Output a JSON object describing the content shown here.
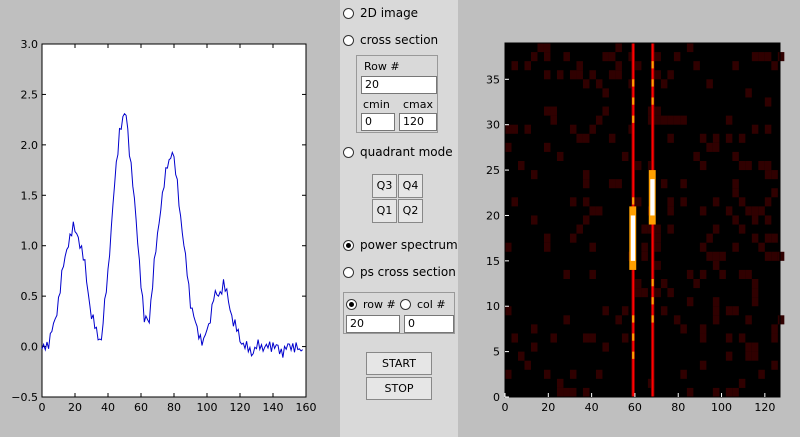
{
  "controls": {
    "mode_2d_image": {
      "label": "2D image",
      "selected": false
    },
    "mode_cross_section": {
      "label": "cross section",
      "selected": false
    },
    "row_label": "Row #",
    "row_value": "20",
    "cmin_label": "cmin",
    "cmax_label": "cmax",
    "cmin_value": "0",
    "cmax_value": "120",
    "quadrant_mode": {
      "label": "quadrant mode",
      "selected": false
    },
    "quadrants": [
      "Q3",
      "Q4",
      "Q1",
      "Q2"
    ],
    "power_spectrum": {
      "label": "power spectrum",
      "selected": true
    },
    "ps_cross_section": {
      "label": "ps cross section",
      "selected": false
    },
    "row_select": {
      "label": "row #",
      "selected": true
    },
    "col_select": {
      "label": "col #",
      "selected": false
    },
    "row_num_value": "20",
    "col_num_value": "0",
    "start_label": "START",
    "stop_label": "STOP"
  },
  "chart_data": [
    {
      "type": "line",
      "xlim": [
        0,
        160
      ],
      "ylim": [
        -0.5,
        3.0
      ],
      "xticks": [
        "0",
        "20",
        "40",
        "60",
        "80",
        "100",
        "120",
        "140",
        "160"
      ],
      "yticks": [
        "−0.5",
        "0.0",
        "0.5",
        "1.0",
        "1.5",
        "2.0",
        "2.5",
        "3.0"
      ],
      "line_color": "#0000cc",
      "x": [
        0,
        4,
        8,
        12,
        16,
        19,
        22,
        26,
        30,
        33,
        36,
        40,
        44,
        47,
        49,
        51,
        54,
        58,
        62,
        65,
        68,
        72,
        76,
        79,
        82,
        86,
        90,
        94,
        98,
        101,
        104,
        107,
        110,
        113,
        116,
        120,
        124,
        128,
        132,
        136,
        140,
        144,
        148,
        152,
        156,
        158
      ],
      "y": [
        -0.05,
        0.05,
        0.25,
        0.7,
        1.05,
        1.17,
        1.1,
        0.8,
        0.3,
        0.15,
        0.06,
        0.75,
        1.6,
        2.15,
        2.25,
        2.3,
        1.8,
        1.05,
        0.25,
        0.28,
        0.8,
        1.4,
        1.8,
        1.95,
        1.6,
        1.0,
        0.45,
        0.15,
        0.05,
        0.2,
        0.5,
        0.5,
        0.63,
        0.45,
        0.25,
        0.08,
        -0.02,
        -0.05,
        0.02,
        -0.02,
        0.03,
        -0.05,
        -0.02,
        0.02,
        -0.05,
        -0.03
      ]
    },
    {
      "type": "heatmap",
      "xlim": [
        0,
        127
      ],
      "ylim": [
        0,
        39
      ],
      "xticks": [
        "0",
        "20",
        "40",
        "60",
        "80",
        "100",
        "120"
      ],
      "yticks": [
        "0",
        "5",
        "10",
        "15",
        "20",
        "25",
        "30",
        "35"
      ],
      "colormap": [
        "#000000",
        "#300000",
        "#800000",
        "#ff0000",
        "#ffa000",
        "#ffffff"
      ],
      "bright_columns": [
        59,
        68
      ],
      "hotspots": [
        {
          "x": 59,
          "y0": 15,
          "y1": 20,
          "color": "#ffffff"
        },
        {
          "x": 68,
          "y0": 20,
          "y1": 24,
          "color": "#ffffff"
        }
      ]
    }
  ]
}
